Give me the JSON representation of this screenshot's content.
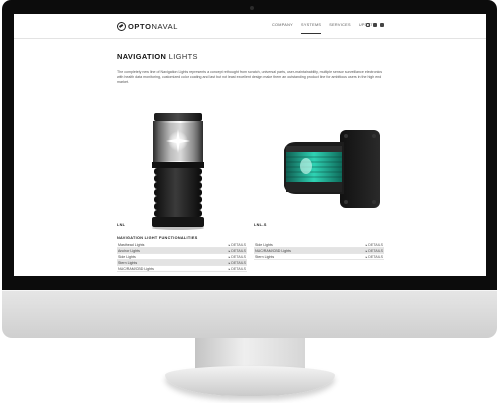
{
  "site": {
    "logo_bold": "OPTO",
    "logo_light": "NAVAL"
  },
  "nav": {
    "items": [
      {
        "label": "COMPANY",
        "active": false
      },
      {
        "label": "SYSTEMS",
        "active": true
      },
      {
        "label": "SERVICES",
        "active": false
      },
      {
        "label": "UPDATE",
        "active": false
      }
    ],
    "social_icons": [
      "instagram-icon",
      "linkedin-icon",
      "facebook-icon"
    ]
  },
  "page": {
    "title_bold": "NAVIGATION",
    "title_light": "LIGHTS",
    "intro": "The completely new line of Navigation Lights represents a concept rethought from scratch, universal parts, user-maintainability, multiple sensor surveillance electronics with health data monitoring, customized color coating and last but not least excellent design make them an outstanding product line for ambitious users in the high end market."
  },
  "products": [
    {
      "name": "LNL",
      "icon": "lantern-icon"
    },
    {
      "name": "LNL-S",
      "icon": "wall-mounted-sidelight-icon"
    }
  ],
  "functionalities": {
    "heading": "NAVIGATION LIGHT FUNCTIONALITIES",
    "detail_label": "DETAILS",
    "arrow_icon": "chevron-right-icon",
    "left": [
      {
        "label": "Masthead Lights",
        "shaded": false
      },
      {
        "label": "Anchor Lights",
        "shaded": true
      },
      {
        "label": "Side Lights",
        "shaded": false
      },
      {
        "label": "Stern Lights",
        "shaded": true
      },
      {
        "label": "NUC/RAM/CBD Lights",
        "shaded": false
      }
    ],
    "right": [
      {
        "label": "Side Lights",
        "shaded": false
      },
      {
        "label": "NUC/RAM/CBD Lights",
        "shaded": true
      },
      {
        "label": "Stern Lights",
        "shaded": false
      }
    ]
  },
  "colors": {
    "bezel": "#0c0c0c",
    "lens_green": "#2fd3b4",
    "row_shade": "#e3e3e3"
  }
}
